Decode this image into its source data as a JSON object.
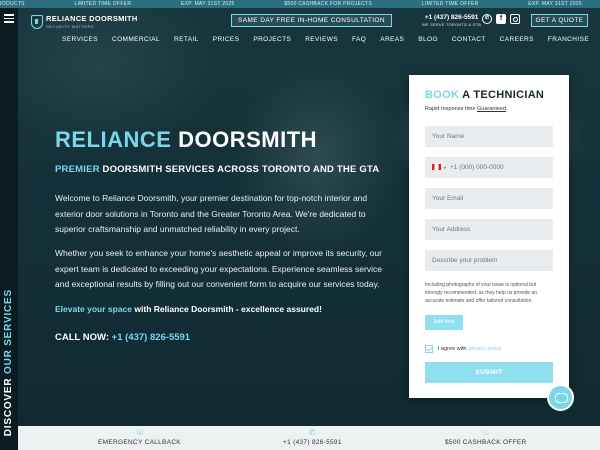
{
  "ticker": [
    "RODUCTS",
    "LIMITED TIME OFFER",
    "EXP. MAY 31ST 2025",
    "$500 CASHBACK FOR PROJECTS",
    "LIMITED TIME OFFER",
    "EXP. MAY 31ST 2025"
  ],
  "sidebar": {
    "discover": "DISCOVER",
    "services": "OUR SERVICES"
  },
  "header": {
    "logo_name": "RELIANCE DOORSMITH",
    "logo_tagline": "SECURITY MATTERS",
    "consult_button": "SAME DAY FREE IN-HOME CONSULTATION",
    "phone": "+1 (437) 826-5591",
    "phone_sub": "WE SERVE TORONTO & GTA",
    "quote_button": "GET A QUOTE"
  },
  "nav": [
    "SERVICES",
    "COMMERCIAL",
    "RETAIL",
    "PRICES",
    "PROJECTS",
    "REVIEWS",
    "FAQ",
    "AREAS",
    "BLOG",
    "CONTACT",
    "CAREERS",
    "FRANCHISE"
  ],
  "hero": {
    "title_hl": "RELIANCE",
    "title_rest": "DOORSMITH",
    "subtitle_hl": "PREMIER",
    "subtitle_rest": "DOORSMITH SERVICES ACROSS TORONTO AND THE GTA",
    "para1": "Welcome to Reliance Doorsmith, your premier destination for top-notch interior and exterior door solutions in Toronto and the Greater Toronto Area. We're dedicated to superior craftsmanship and unmatched reliability in every project.",
    "para2": "Whether you seek to enhance your home's aesthetic appeal or improve its security, our expert team is dedicated to exceeding your expectations. Experience seamless service and exceptional results by filling out our convenient form to acquire our services today.",
    "tagline_hl": "Elevate your space",
    "tagline_rest": "with Reliance Doorsmith - excellence assured!",
    "call_label": "CALL NOW:",
    "call_number": "+1 (437) 826-5591"
  },
  "form": {
    "title_hl": "BOOK",
    "title_rest": "A TECHNICIAN",
    "sub_text": "Rapid response time",
    "sub_link": "Guaranteed",
    "name_placeholder": "Your Name",
    "phone_placeholder": "+1 (000) 000-0000",
    "email_placeholder": "Your Email",
    "address_placeholder": "Your Address",
    "problem_placeholder": "Describe your problem",
    "note": "Including photographs of your issue is optional but strongly recommended, as they help us provide an accurate estimate and offer tailored consultation.",
    "add_files": "Add files",
    "agree_text": "I agree with",
    "privacy_link": "privacy policy",
    "submit": "SUBMIT"
  },
  "bottom": {
    "callback": "EMERGENCY CALLBACK",
    "phone": "+1 (437) 826-5591",
    "cashback": "$500 CASHBACK OFFER"
  },
  "colors": {
    "accent": "#7ad7ea",
    "dark": "#0f2b33"
  }
}
